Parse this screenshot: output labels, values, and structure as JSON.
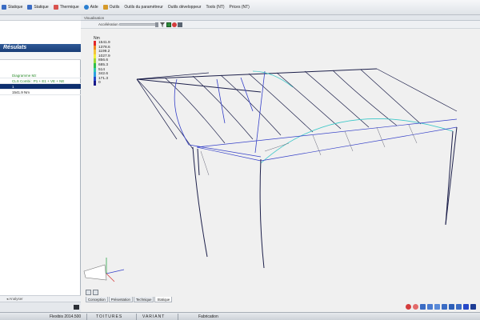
{
  "menu": {
    "items": [
      {
        "label": "Statique",
        "icon": "statique-icon",
        "color": "#3b6cc4"
      },
      {
        "label": "Statique",
        "icon": "statique2-icon",
        "color": "#3b6cc4"
      },
      {
        "label": "Thermique",
        "icon": "thermique-icon",
        "color": "#d9534f"
      },
      {
        "label": "Aide",
        "icon": "help-icon",
        "color": "#2a7fd1"
      },
      {
        "label": "Outils",
        "icon": "tools-icon",
        "color": "#d69a2b"
      },
      {
        "label": "Outils du paramétreur",
        "icon": "",
        "color": ""
      },
      {
        "label": "Outils développeur",
        "icon": "",
        "color": ""
      },
      {
        "label": "Tools (NT)",
        "icon": "",
        "color": ""
      },
      {
        "label": "Prices (NT)",
        "icon": "",
        "color": ""
      }
    ]
  },
  "left_panel": {
    "results_title": "Résulats",
    "rows": [
      {
        "label": "Diagramme Mz",
        "style": "green"
      },
      {
        "label": "CLS Combi : P1 + E1 + VE + NE",
        "style": "green"
      },
      {
        "label": "1",
        "style": "selected"
      },
      {
        "label": "1541.9 Nm",
        "style": "normal"
      }
    ],
    "analyser_label": "◂ Analyser"
  },
  "viewport": {
    "title": "Visualisation",
    "acceleration_label": "Accélération",
    "legend": {
      "unit": "Nm",
      "entries": [
        {
          "value": "1541.9",
          "color": "#e3262b"
        },
        {
          "value": "1378.6",
          "color": "#f08a24"
        },
        {
          "value": "1199.2",
          "color": "#f3c43a"
        },
        {
          "value": "1027.9",
          "color": "#f2ee3b"
        },
        {
          "value": "856.6",
          "color": "#9ed93a"
        },
        {
          "value": "685.3",
          "color": "#2fbf4a"
        },
        {
          "value": "514",
          "color": "#2ec7b0"
        },
        {
          "value": "342.6",
          "color": "#2d9fe0"
        },
        {
          "value": "171.3",
          "color": "#2748c9"
        },
        {
          "value": "0",
          "color": "#1a1a8a"
        }
      ]
    },
    "tabs": [
      {
        "label": "Conception",
        "active": false
      },
      {
        "label": "Présentation",
        "active": false
      },
      {
        "label": "Technique",
        "active": false
      },
      {
        "label": "Statique",
        "active": true
      }
    ]
  },
  "status_bar": {
    "version": "Flexibis 2014.500",
    "toitures": "TOITURES",
    "variant": "VARIANT",
    "fabrication": "Fabrication"
  },
  "colors": {
    "accent": "#1a3e77",
    "selected_row": "#0d2f6e",
    "green_text": "#2a8a2a",
    "member_dark": "#1c1f4a",
    "member_blue": "#3540c8",
    "member_teal": "#3cc8c8"
  }
}
